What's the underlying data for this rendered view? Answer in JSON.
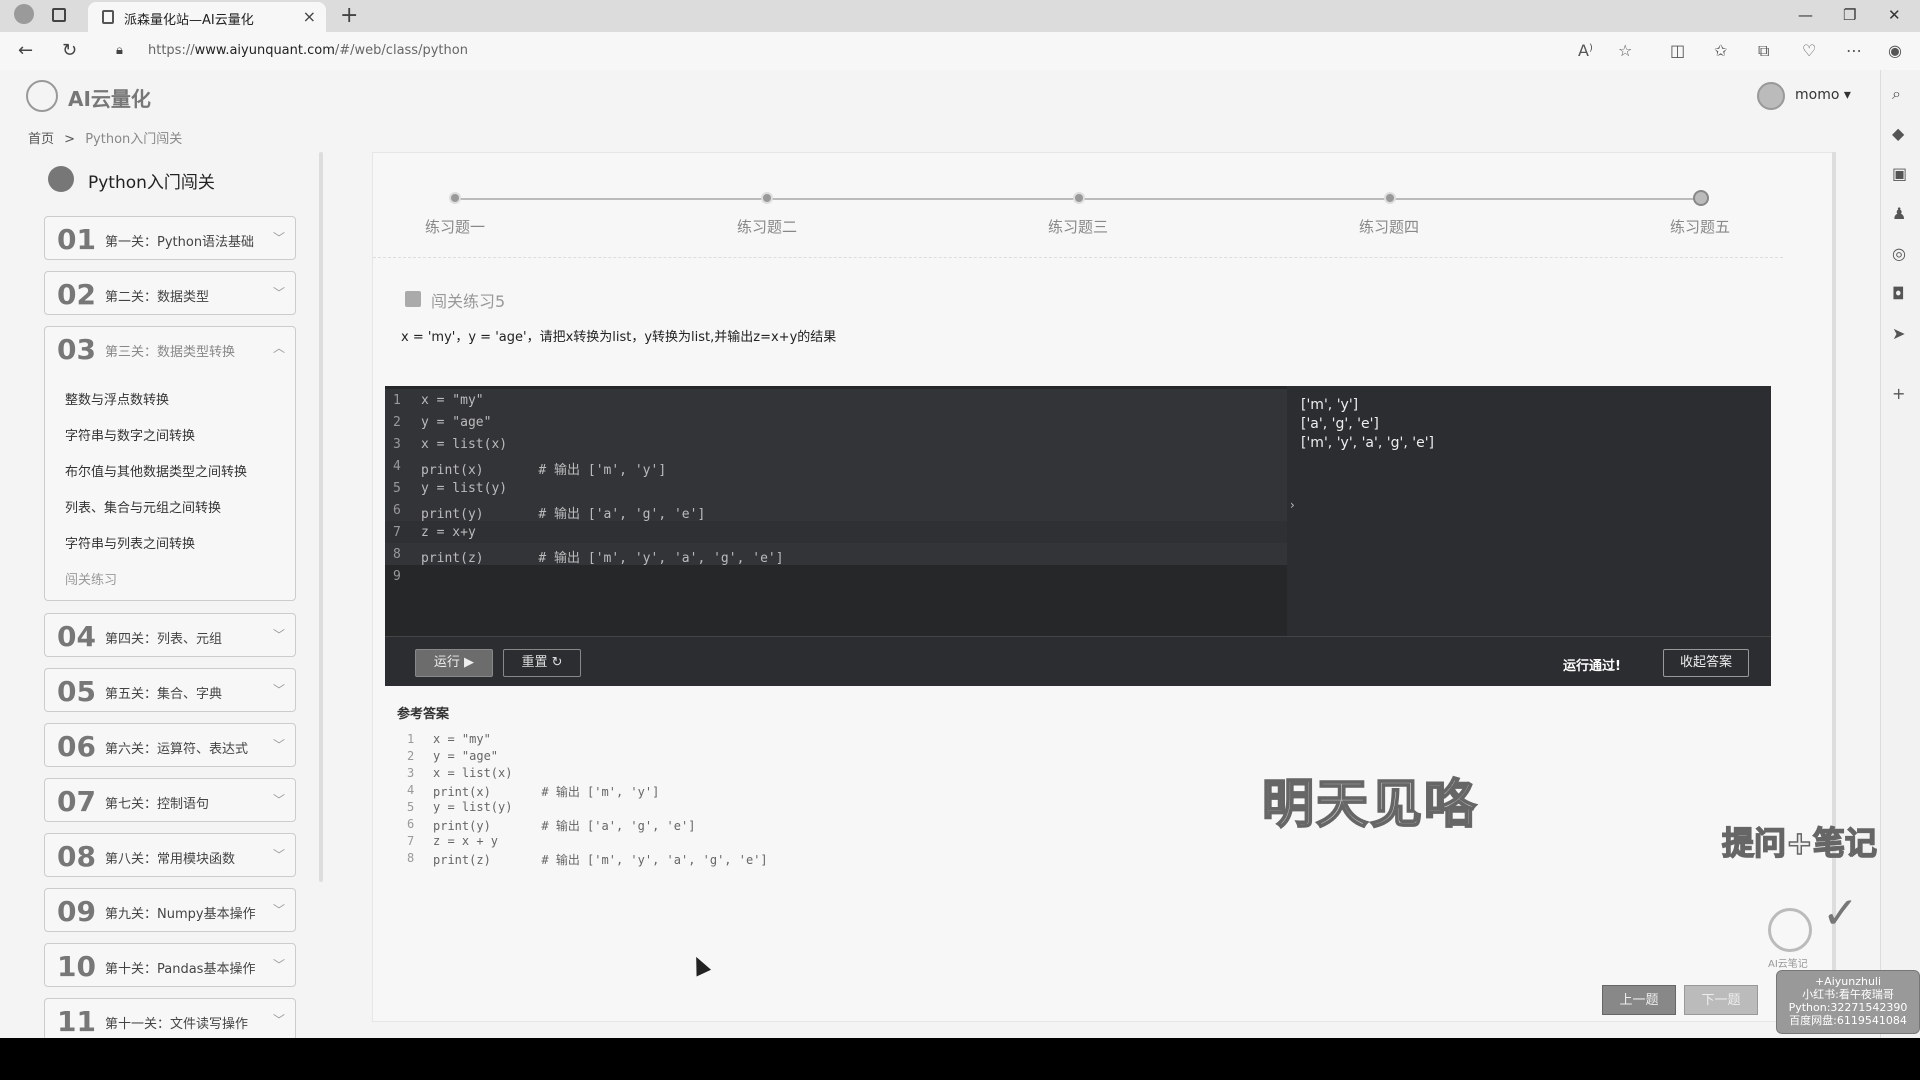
{
  "browser": {
    "tab_title": "派森量化站—AI云量化",
    "url_prefix": "https://",
    "url_host": "www.aiyunquant.com",
    "url_path": "/#/web/class/python"
  },
  "header": {
    "logo_text": "AI云量化",
    "user_name": "momo ▾"
  },
  "breadcrumb": {
    "home": "首页",
    "sep": ">",
    "current": "Python入门闯关"
  },
  "sidebar": {
    "title": "Python入门闯关",
    "levels": [
      {
        "num": "01",
        "name": "第一关：Python语法基础"
      },
      {
        "num": "02",
        "name": "第二关：数据类型"
      },
      {
        "num": "03",
        "name": "第三关：数据类型转换"
      },
      {
        "num": "04",
        "name": "第四关：列表、元组"
      },
      {
        "num": "05",
        "name": "第五关：集合、字典"
      },
      {
        "num": "06",
        "name": "第六关：运算符、表达式"
      },
      {
        "num": "07",
        "name": "第七关：控制语句"
      },
      {
        "num": "08",
        "name": "第八关：常用模块函数"
      },
      {
        "num": "09",
        "name": "第九关：Numpy基本操作"
      },
      {
        "num": "10",
        "name": "第十关：Pandas基本操作"
      },
      {
        "num": "11",
        "name": "第十一关：文件读写操作"
      }
    ],
    "sub_items": [
      "整数与浮点数转换",
      "字符串与数字之间转换",
      "布尔值与其他数据类型之间转换",
      "列表、集合与元组之间转换",
      "字符串与列表之间转换",
      "闯关练习"
    ]
  },
  "steps": [
    "练习题一",
    "练习题二",
    "练习题三",
    "练习题四",
    "练习题五"
  ],
  "exercise": {
    "title": "闯关练习5",
    "description": "x = 'my'，y = 'age'，请把x转换为list，y转换为list,并输出z=x+y的结果"
  },
  "editor": {
    "lines": [
      "x = \"my\"",
      "y = \"age\"",
      "x = list(x)",
      "print(x)       # 输出 ['m', 'y']",
      "y = list(y)",
      "print(y)       # 输出 ['a', 'g', 'e']",
      "z = x+y",
      "print(z)       # 输出 ['m', 'y', 'a', 'g', 'e']",
      ""
    ],
    "output": [
      "['m', 'y']",
      "['a', 'g', 'e']",
      "['m', 'y', 'a', 'g', 'e']"
    ],
    "run_label": "运行 ▶",
    "reset_label": "重置 ↻",
    "status": "运行通过!",
    "fold_label": "收起答案"
  },
  "reference": {
    "title": "参考答案",
    "lines": [
      "x = \"my\"",
      "y = \"age\"",
      "x = list(x)",
      "print(x)       # 输出 ['m', 'y']",
      "y = list(y)",
      "print(y)       # 输出 ['a', 'g', 'e']",
      "z = x + y",
      "print(z)       # 输出 ['m', 'y', 'a', 'g', 'e']"
    ]
  },
  "overlay": {
    "big_text": "明天见咯",
    "note_text": "提问+笔记",
    "ai_label": "AI云笔记"
  },
  "nav": {
    "prev": "上一题",
    "next": "下一题"
  },
  "watermark": {
    "line1": "+Aiyunzhuli",
    "line2": "小红书:看午夜瑞哥",
    "line3": "Python:32271542390",
    "line4": "百度网盘:6119541084"
  }
}
